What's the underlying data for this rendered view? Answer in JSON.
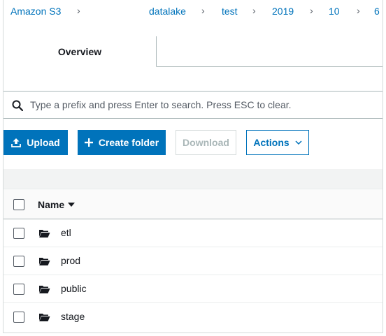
{
  "breadcrumb": {
    "items": [
      "Amazon S3",
      "datalake",
      "test",
      "2019",
      "10",
      "6"
    ],
    "separator": "›"
  },
  "tabs": [
    {
      "label": "Overview",
      "active": true
    }
  ],
  "search": {
    "placeholder": "Type a prefix and press Enter to search. Press ESC to clear.",
    "value": ""
  },
  "toolbar": {
    "upload_label": "Upload",
    "create_folder_label": "Create folder",
    "download_label": "Download",
    "actions_label": "Actions"
  },
  "table": {
    "name_header": "Name",
    "rows": [
      {
        "name": "etl",
        "type": "folder"
      },
      {
        "name": "prod",
        "type": "folder"
      },
      {
        "name": "public",
        "type": "folder"
      },
      {
        "name": "stage",
        "type": "folder"
      }
    ]
  },
  "icons": {
    "search": "search-icon",
    "upload": "upload-icon",
    "create_folder": "plus-icon",
    "actions": "chevron-down-icon",
    "sort": "caret-down-icon",
    "folder": "folder-open-icon"
  },
  "colors": {
    "primary": "#0073bb",
    "text": "#16191f",
    "border": "#aab7b8",
    "band": "#f2f3f3"
  }
}
